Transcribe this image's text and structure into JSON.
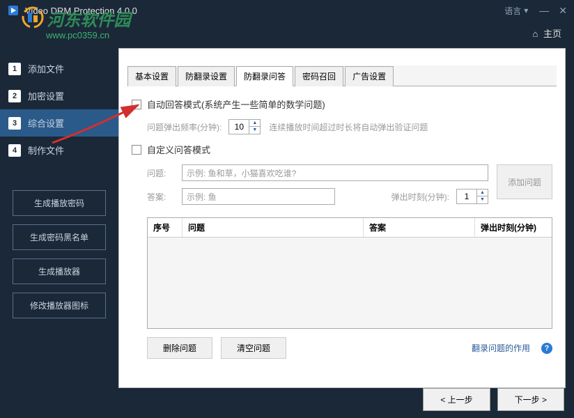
{
  "app": {
    "title": "Video DRM Protection 4.0.0",
    "language_label": "语言"
  },
  "watermark": {
    "text": "河东软件园",
    "url": "www.pc0359.cn"
  },
  "breadcrumb": {
    "home": "主页"
  },
  "sidebar": {
    "steps": [
      {
        "num": "1",
        "label": "添加文件"
      },
      {
        "num": "2",
        "label": "加密设置"
      },
      {
        "num": "3",
        "label": "综合设置"
      },
      {
        "num": "4",
        "label": "制作文件"
      }
    ],
    "buttons": [
      "生成播放密码",
      "生成密码黑名单",
      "生成播放器",
      "修改播放器图标"
    ]
  },
  "tabs": [
    "基本设置",
    "防翻录设置",
    "防翻录问答",
    "密码召回",
    "广告设置"
  ],
  "panel": {
    "auto_mode": "自动回答模式(系统产生一些简单的数学问题)",
    "freq_label": "问题弹出频率(分钟):",
    "freq_value": "10",
    "freq_hint": "连续播放时间超过时长将自动弹出验证问题",
    "custom_mode": "自定义问答模式",
    "q_label": "问题:",
    "q_placeholder": "示例: 鱼和草，小猫喜欢吃谁?",
    "a_label": "答案:",
    "a_placeholder": "示例: 鱼",
    "pop_label": "弹出时刻(分钟):",
    "pop_value": "1",
    "add_btn": "添加问题",
    "table": {
      "col1": "序号",
      "col2": "问题",
      "col3": "答案",
      "col4": "弹出时刻(分钟)"
    },
    "delete_btn": "删除问题",
    "clear_btn": "清空问题",
    "help_link": "翻录问题的作用"
  },
  "footer": {
    "prev": "< 上一步",
    "next": "下一步 >"
  }
}
